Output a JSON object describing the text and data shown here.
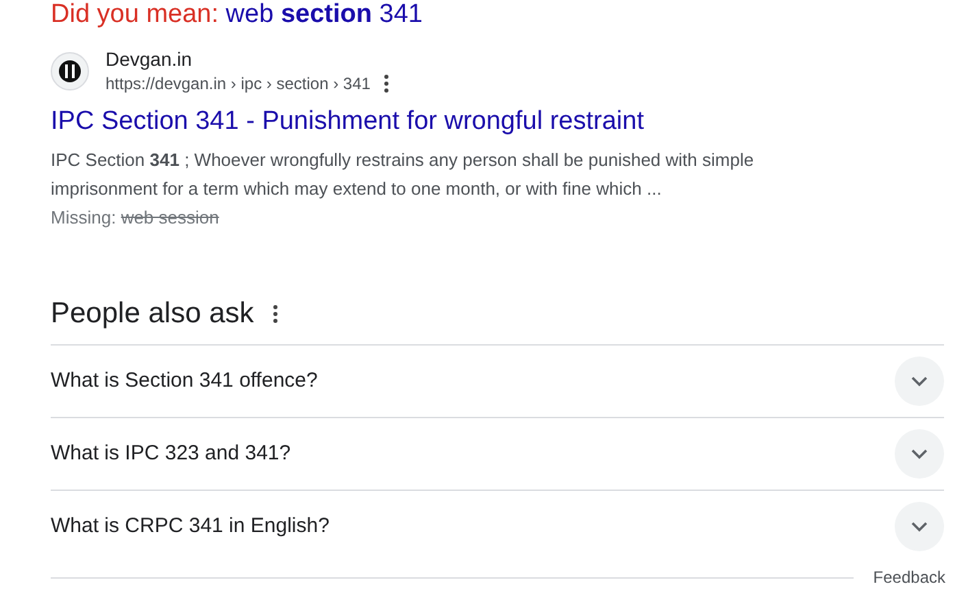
{
  "did_you_mean": {
    "label": "Did you mean:",
    "suggestion": "web **section** 341"
  },
  "result": {
    "site_name": "Devgan.in",
    "breadcrumb": "https://devgan.in › ipc › section › 341",
    "title": "IPC Section 341 - Punishment for wrongful restraint",
    "snippet": "IPC Section **341** ; Whoever wrongfully restrains any person shall be punished with simple imprisonment for a term which may extend to one month, or with fine which ...",
    "missing_label": "Missing:",
    "missing_terms": "web session"
  },
  "people_also_ask": {
    "title": "People also ask",
    "questions": [
      {
        "text": "What is Section 341 offence?",
        "expanded": false
      },
      {
        "text": "What is IPC 323 and 341?",
        "expanded": false
      },
      {
        "text": "What is CRPC 341 in English?",
        "expanded": false
      }
    ]
  },
  "feedback": "Feedback"
}
